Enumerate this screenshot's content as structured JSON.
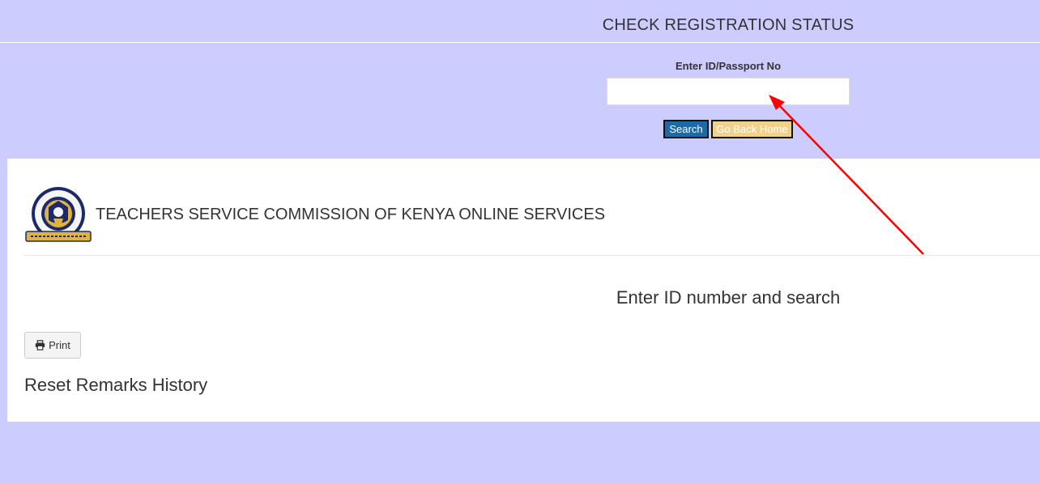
{
  "header": {
    "title": "CHECK REGISTRATION STATUS"
  },
  "search_form": {
    "id_label": "Enter ID/Passport No",
    "id_value": "",
    "search_label": "Search",
    "home_label": "Go Back Home"
  },
  "panel": {
    "org_title": "TEACHERS SERVICE COMMISSION OF KENYA ONLINE SERVICES",
    "logo_icon": "tsc-crest-logo",
    "instruction": "Enter ID number and search",
    "print_icon": "printer-icon",
    "print_label": "Print",
    "history_title": "Reset Remarks History"
  },
  "colors": {
    "page_background": "#ccccff",
    "search_button": "#1f6aa5",
    "home_button": "#f0d28e",
    "annotation_arrow": "#ff0000"
  }
}
